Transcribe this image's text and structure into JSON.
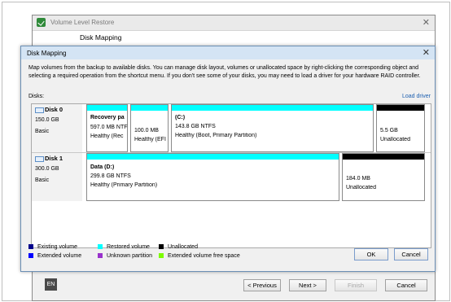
{
  "background_window": {
    "title": "Volume Level Restore",
    "header_title": "Disk Mapping",
    "language_badge": "EN",
    "buttons": {
      "previous": "< Previous",
      "next": "Next >",
      "finish": "Finish",
      "cancel": "Cancel"
    }
  },
  "dialog": {
    "title": "Disk Mapping",
    "description": "Map volumes from the backup to available disks. You can manage disk layout, volumes or unallocated space by right-clicking the corresponding object and selecting a required operation from the shortcut menu. If you don't see some of your disks, you may need to load a driver for your hardware RAID controller.",
    "disks_label": "Disks:",
    "load_driver_link": "Load driver",
    "disks": [
      {
        "name": "Disk 0",
        "size": "150.0 GB",
        "type": "Basic",
        "partitions": [
          {
            "label": "Recovery pa",
            "size_fs": "597.0 MB NTF",
            "status": "Healthy (Rec",
            "bar_color": "#00ffff"
          },
          {
            "label": "",
            "size_fs": "100.0 MB",
            "status": "Healthy (EFI",
            "bar_color": "#00ffff"
          },
          {
            "label": "(C:)",
            "size_fs": "143.8 GB NTFS",
            "status": "Healthy (Boot, Primary Partition)",
            "bar_color": "#00ffff"
          },
          {
            "label": "",
            "size_fs": "5.5 GB",
            "status": "Unallocated",
            "bar_color": "#000000"
          }
        ]
      },
      {
        "name": "Disk 1",
        "size": "300.0 GB",
        "type": "Basic",
        "partitions": [
          {
            "label": "Data (D:)",
            "size_fs": "299.8 GB NTFS",
            "status": "Healthy (Primary Partition)",
            "bar_color": "#00ffff"
          },
          {
            "label": "",
            "size_fs": "184.0 MB",
            "status": "Unallocated",
            "bar_color": "#000000"
          }
        ]
      }
    ],
    "legend": [
      {
        "label": "Existing volume",
        "color": "#00008b"
      },
      {
        "label": "Restored volume",
        "color": "#00ffff"
      },
      {
        "label": "Unallocated",
        "color": "#000000"
      },
      {
        "label": "Extended volume",
        "color": "#0000ff"
      },
      {
        "label": "Unknown partition",
        "color": "#9932cc"
      },
      {
        "label": "Extended volume free space",
        "color": "#7cfc00"
      }
    ],
    "buttons": {
      "ok": "OK",
      "cancel": "Cancel"
    }
  }
}
